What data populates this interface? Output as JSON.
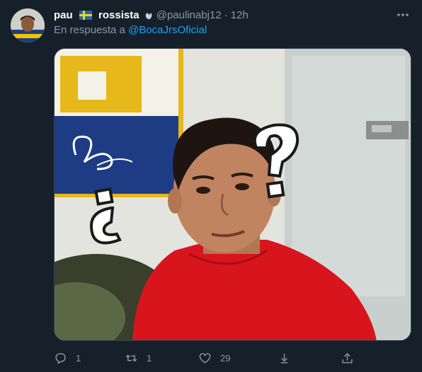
{
  "tweet": {
    "display_name_left": "pau",
    "display_name_right": "rossista",
    "handle": "@paulinabj12",
    "separator": "·",
    "time": "12h",
    "reply_prefix": "En respuesta a",
    "reply_to": "@BocaJrsOficial"
  },
  "actions": {
    "reply_count": "1",
    "retweet_count": "1",
    "like_count": "29"
  },
  "icons": {
    "more": "more-horizontal-icon",
    "reply": "reply-icon",
    "retweet": "retweet-icon",
    "like": "heart-icon",
    "share": "share-icon",
    "flag": "sweden-flag-icon",
    "badge": "clapping-hand-icon"
  },
  "colors": {
    "background": "#15202b",
    "muted_text": "#8899a6",
    "link": "#1da1f2",
    "jersey_red": "#d8151d"
  }
}
